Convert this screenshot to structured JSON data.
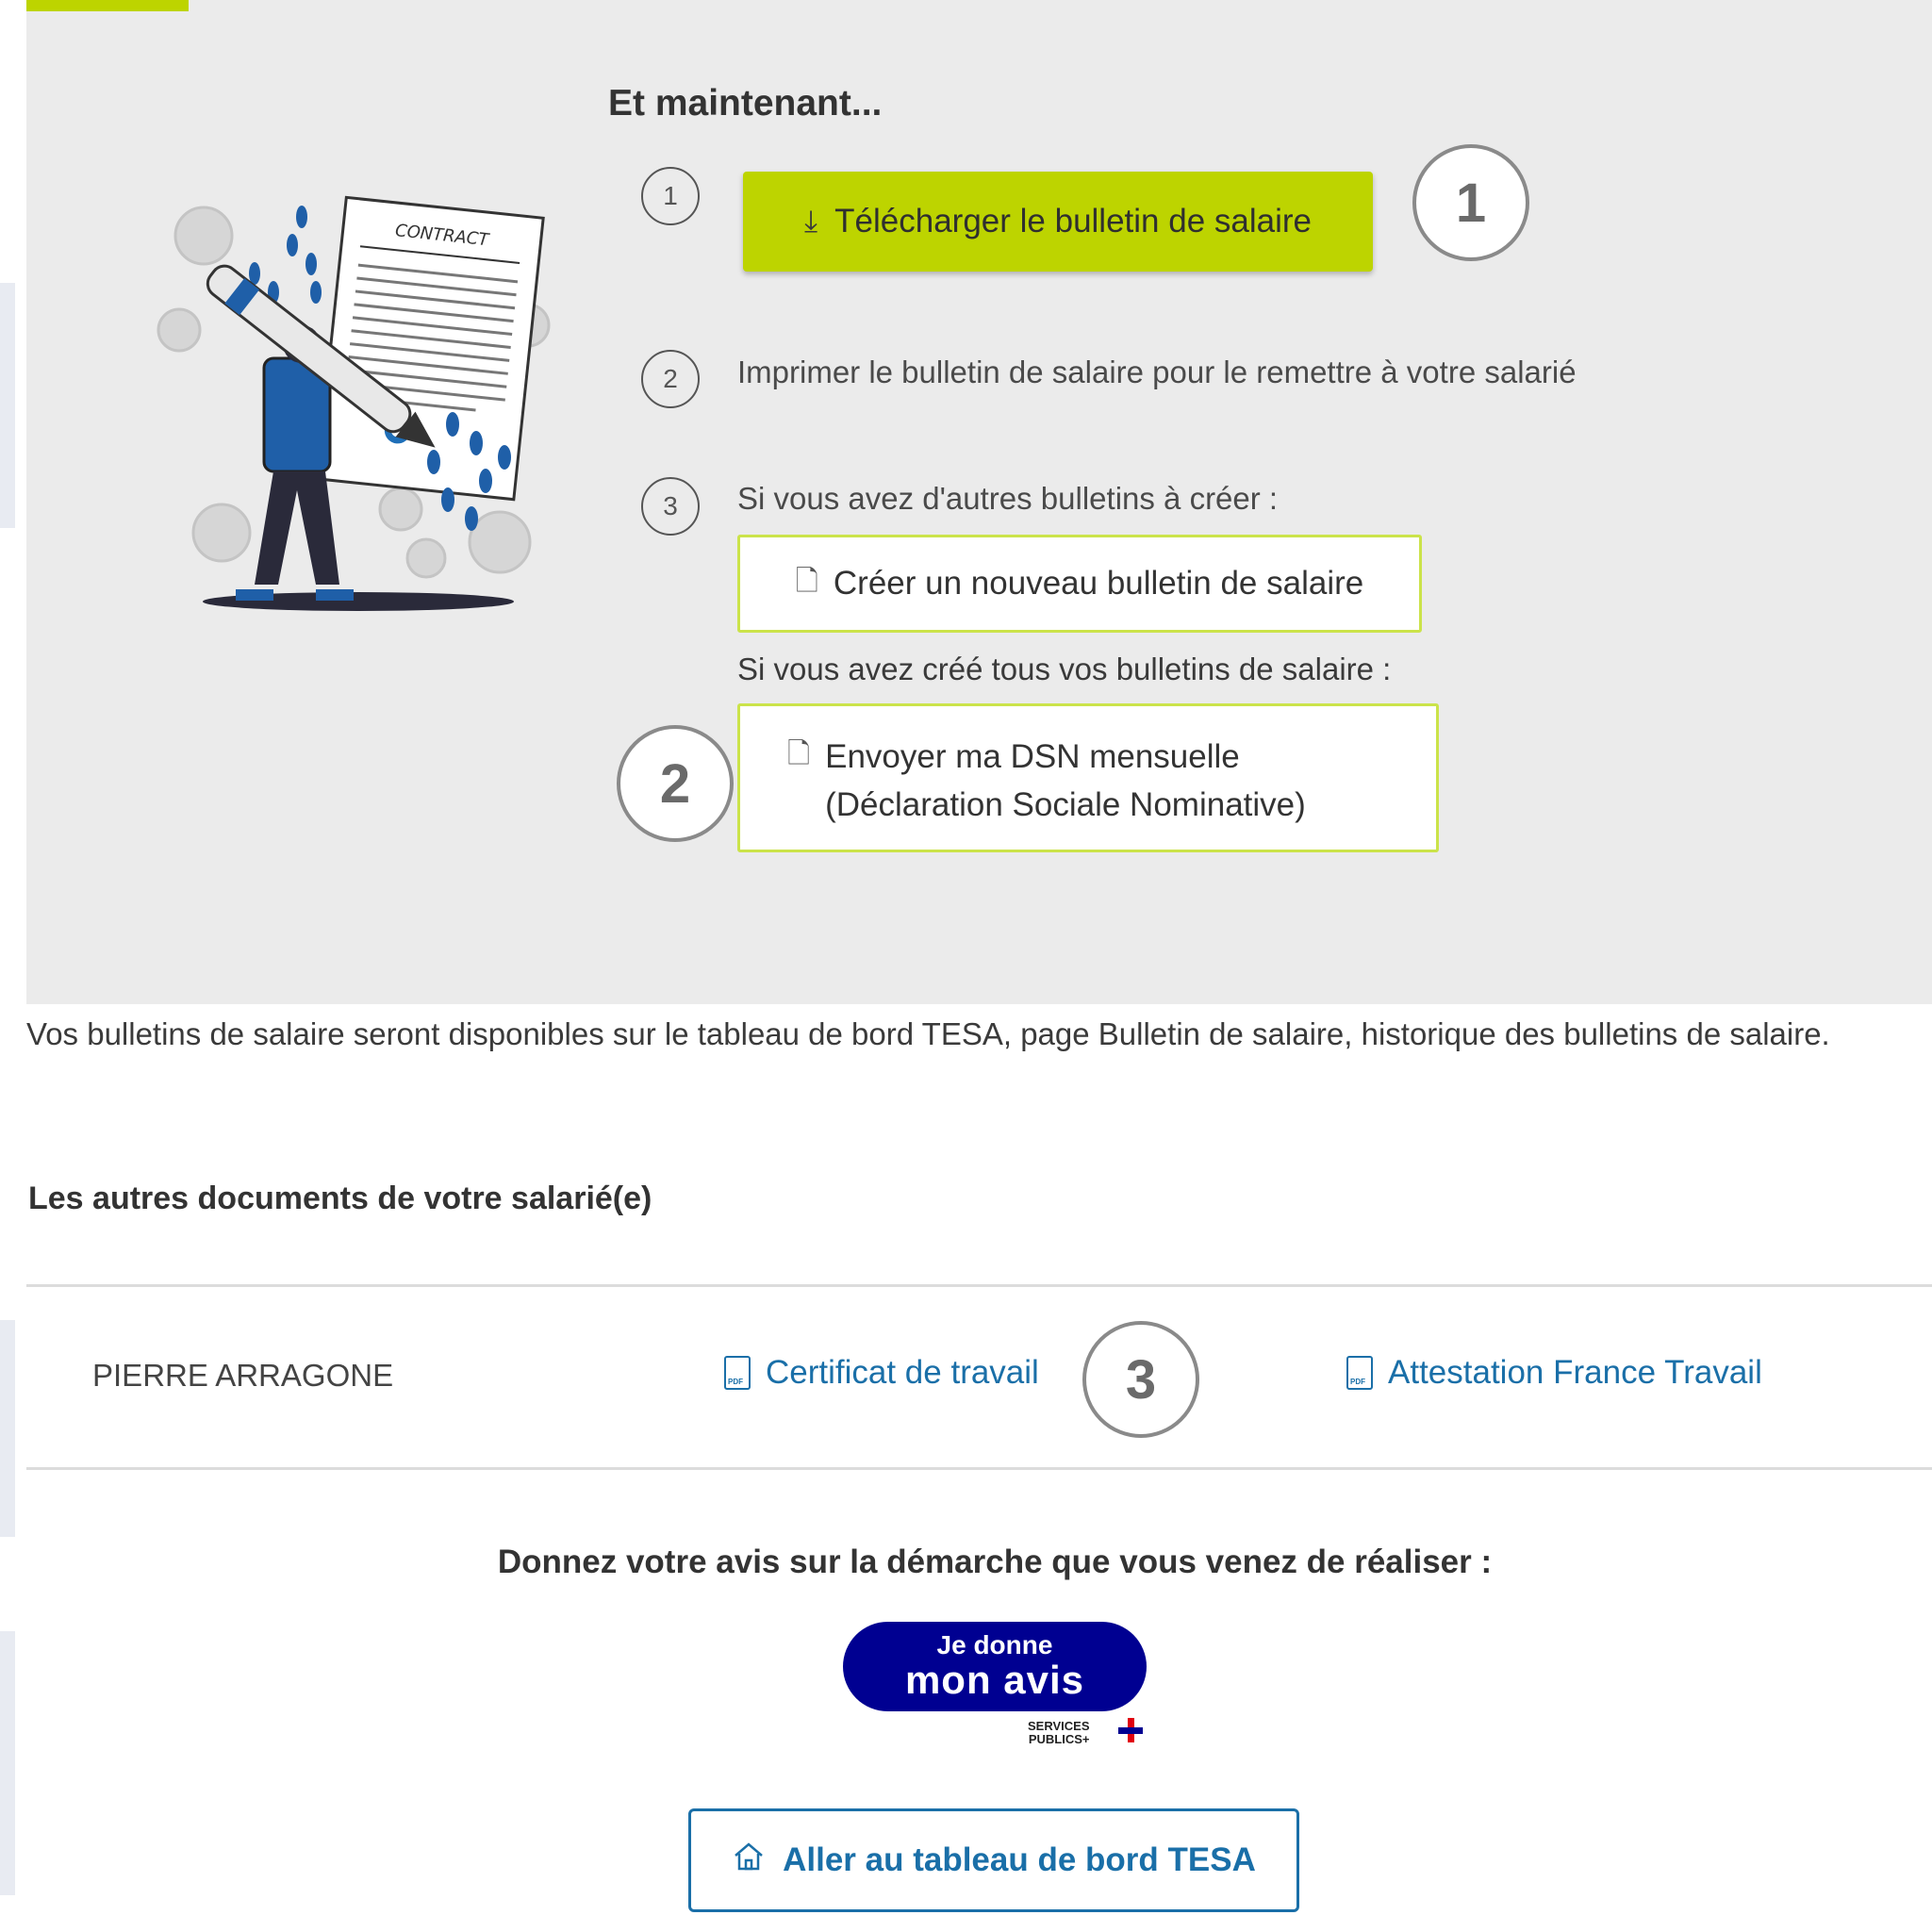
{
  "colors": {
    "panel_bg": "#ebebeb",
    "primary_green": "#bdd400",
    "outline_green": "#cbe34a",
    "link_blue": "#1a6fa8",
    "services_publics_blue": "#000091"
  },
  "illustration": {
    "contract_label": "CONTRACT"
  },
  "next_steps": {
    "heading": "Et maintenant...",
    "step1": {
      "number": "1",
      "button_label": "Télécharger le bulletin de salaire",
      "button_icon": "download-icon"
    },
    "step2": {
      "number": "2",
      "text": "Imprimer le bulletin de salaire pour le remettre à votre salarié"
    },
    "step3": {
      "number": "3",
      "text": "Si vous avez d'autres bulletins à créer :",
      "create_button_label": "Créer un nouveau bulletin de salaire",
      "create_button_icon": "file-plus-icon",
      "all_created_text": "Si vous avez créé tous vos bulletins de salaire :",
      "dsn_button_line1": "Envoyer ma DSN mensuelle",
      "dsn_button_line2": "(Déclaration Sociale Nominative)",
      "dsn_button_icon": "file-icon"
    }
  },
  "callouts": [
    "1",
    "2",
    "3"
  ],
  "info_text": "Vos bulletins de salaire seront disponibles sur le tableau de bord TESA, page Bulletin de salaire, historique des bulletins de salaire.",
  "other_docs": {
    "title": "Les autres documents de votre salarié(e)",
    "employee_name": "PIERRE ARRAGONE",
    "link1": "Certificat de travail",
    "link2": "Attestation France Travail",
    "pdf_icon_label": "PDF"
  },
  "feedback": {
    "title": "Donnez votre avis sur la démarche que vous venez de réaliser :",
    "button_line1": "Je donne",
    "button_line2": "mon avis",
    "brand_line1": "SERVICES",
    "brand_line2": "PUBLICS+"
  },
  "dashboard_button": {
    "label": "Aller au tableau de bord TESA",
    "icon": "home-icon"
  }
}
